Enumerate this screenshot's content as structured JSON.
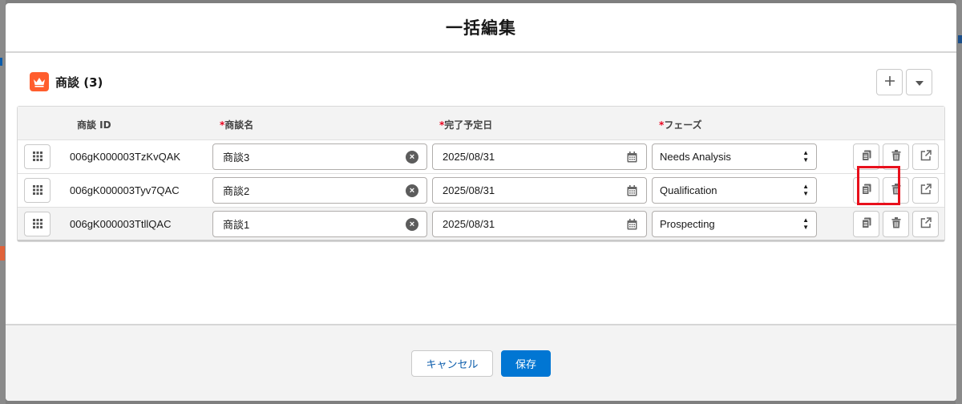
{
  "modal": {
    "title": "一括編集"
  },
  "card": {
    "title": "商談 (3)"
  },
  "columns": {
    "id": "商談 ID",
    "name": "商談名",
    "close_date": "完了予定日",
    "stage": "フェーズ",
    "required_mark": "*"
  },
  "rows": [
    {
      "id": "006gK000003TzKvQAK",
      "name": "商談3",
      "close_date": "2025/08/31",
      "stage": "Needs Analysis"
    },
    {
      "id": "006gK000003Tyv7QAC",
      "name": "商談2",
      "close_date": "2025/08/31",
      "stage": "Qualification"
    },
    {
      "id": "006gK000003TtllQAC",
      "name": "商談1",
      "close_date": "2025/08/31",
      "stage": "Prospecting"
    }
  ],
  "footer": {
    "cancel_label": "キャンセル",
    "save_label": "保存"
  },
  "colors": {
    "brand": "#0176d3",
    "object_icon": "#ff5d2d",
    "required": "#ea001e",
    "highlight": "#e8101c"
  },
  "icons": {
    "object": "crown-icon",
    "add": "plus-icon",
    "menu": "chevron-down-icon",
    "drag": "grip-icon",
    "clear": "clear-icon",
    "date": "calendar-icon",
    "clone": "copy-icon",
    "delete": "trash-icon",
    "open": "external-link-icon"
  }
}
